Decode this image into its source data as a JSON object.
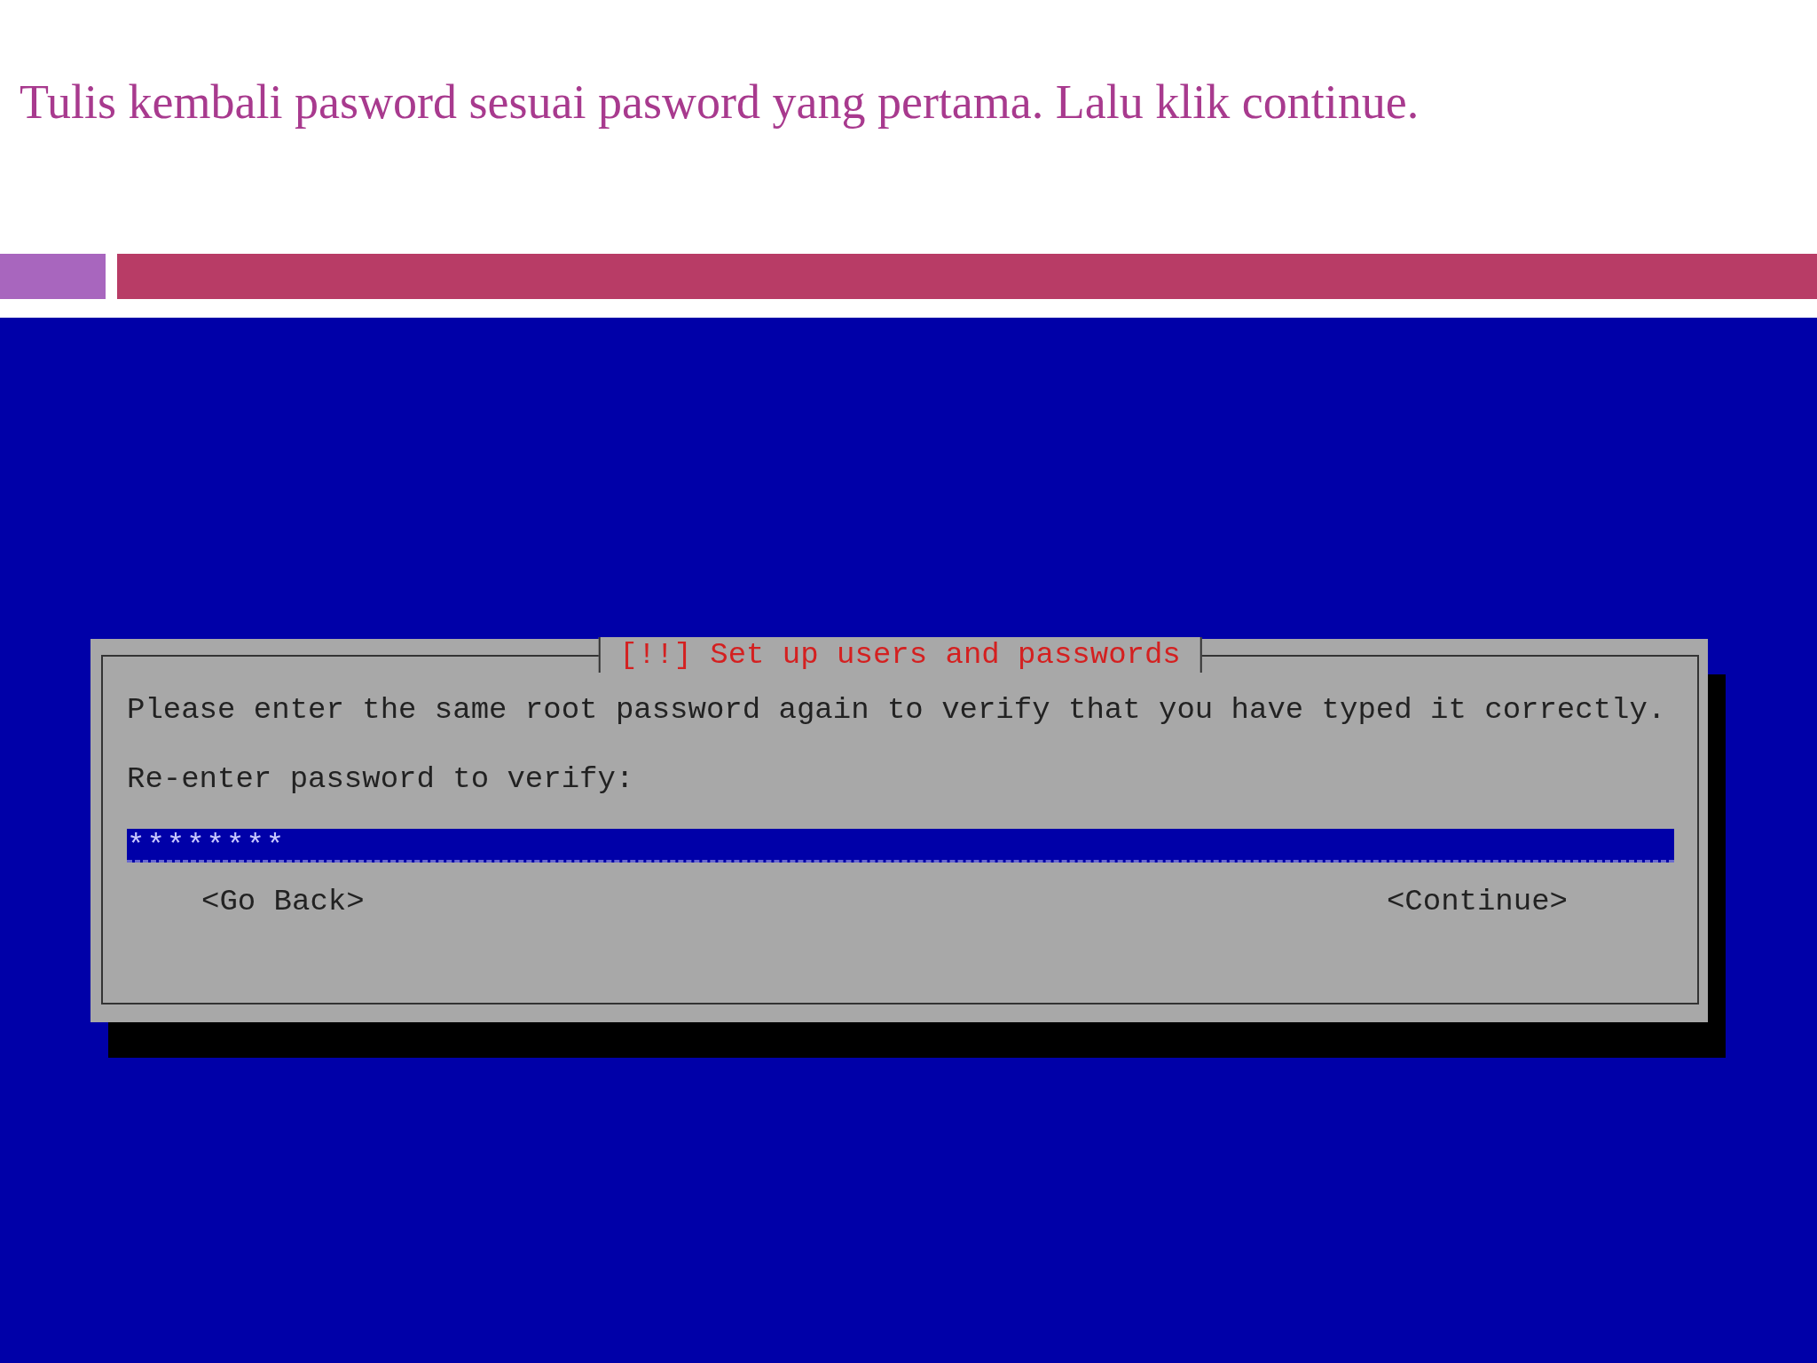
{
  "slide": {
    "title": "Tulis kembali pasword sesuai pasword yang pertama. Lalu klik continue."
  },
  "dialog": {
    "title": "[!!] Set up users and passwords",
    "message": "Please enter the same root password again to verify that you have typed it correctly.",
    "prompt": "Re-enter password to verify:",
    "password": {
      "value": "********"
    },
    "buttons": [
      {
        "label": "<Go Back>"
      },
      {
        "label": "<Continue>"
      }
    ]
  }
}
